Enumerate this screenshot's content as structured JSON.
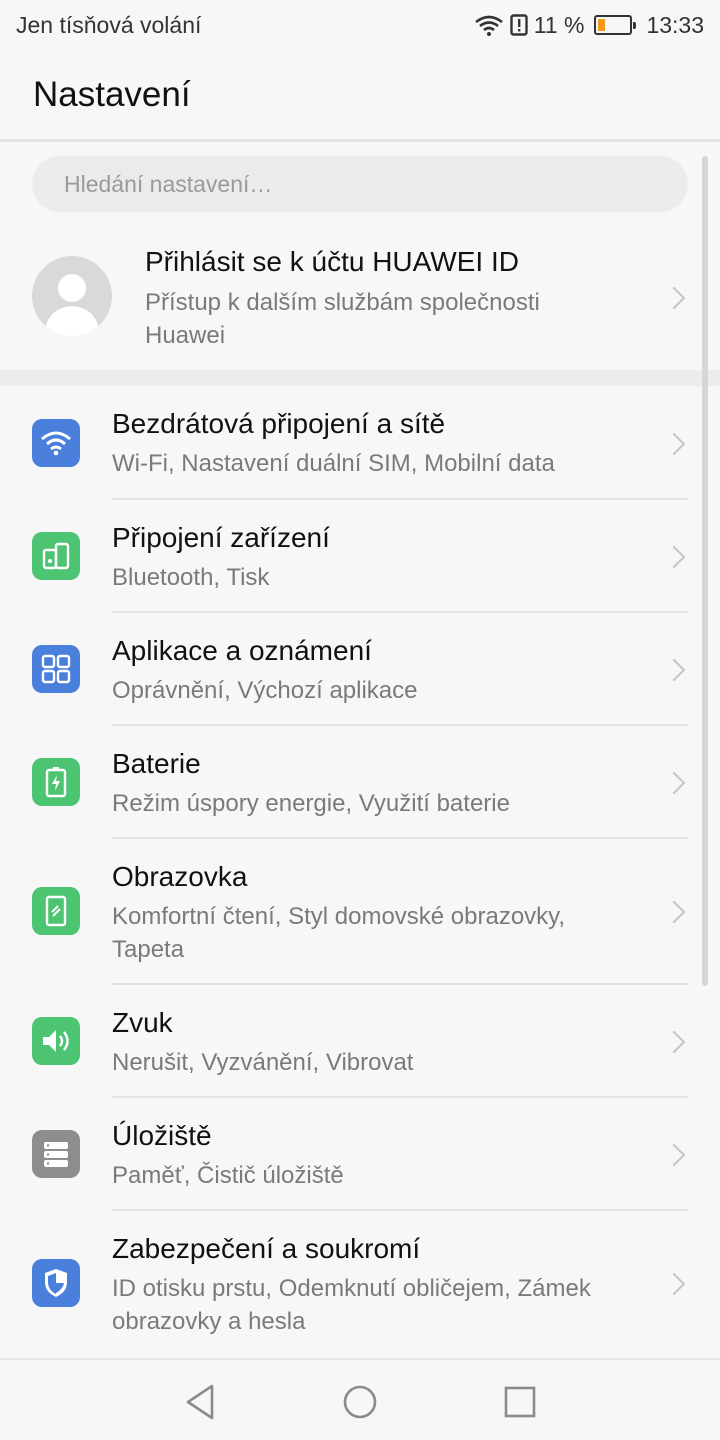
{
  "status_bar": {
    "carrier": "Jen tísňová volání",
    "battery_percent": "11 %",
    "battery_level": 0.11,
    "time": "13:33",
    "icons": [
      "wifi-icon",
      "alert-icon",
      "battery-icon"
    ]
  },
  "header": {
    "title": "Nastavení"
  },
  "search": {
    "placeholder": "Hledání nastavení…"
  },
  "account": {
    "title": "Přihlásit se k účtu HUAWEI ID",
    "subtitle": "Přístup k dalším službám společnosti Huawei",
    "icon": "avatar-icon"
  },
  "colors": {
    "blue": "#4a7fdc",
    "green": "#4cc472",
    "gray": "#8d8d8d",
    "battery_low": "#f29a1e"
  },
  "settings": {
    "items": [
      {
        "title": "Bezdrátová připojení a sítě",
        "subtitle": "Wi-Fi, Nastavení duální SIM, Mobilní data",
        "icon": "wifi-icon",
        "color": "#4a7fdc"
      },
      {
        "title": "Připojení zařízení",
        "subtitle": "Bluetooth, Tisk",
        "icon": "device-connection-icon",
        "color": "#4cc472"
      },
      {
        "title": "Aplikace a oznámení",
        "subtitle": "Oprávnění, Výchozí aplikace",
        "icon": "apps-icon",
        "color": "#4a7fdc"
      },
      {
        "title": "Baterie",
        "subtitle": "Režim úspory energie, Využití baterie",
        "icon": "battery-icon",
        "color": "#4cc472"
      },
      {
        "title": "Obrazovka",
        "subtitle": "Komfortní čtení, Styl domovské obrazovky, Tapeta",
        "icon": "display-icon",
        "color": "#4cc472"
      },
      {
        "title": "Zvuk",
        "subtitle": "Nerušit, Vyzvánění, Vibrovat",
        "icon": "sound-icon",
        "color": "#4cc472"
      },
      {
        "title": "Úložiště",
        "subtitle": "Paměť, Čistič úložiště",
        "icon": "storage-icon",
        "color": "#8d8d8d"
      },
      {
        "title": "Zabezpečení a soukromí",
        "subtitle": "ID otisku prstu, Odemknutí obličejem, Zámek obrazovky a hesla",
        "icon": "shield-icon",
        "color": "#4a7fdc"
      }
    ]
  },
  "navbar": {
    "buttons": [
      "back-icon",
      "home-icon",
      "recents-icon"
    ]
  }
}
